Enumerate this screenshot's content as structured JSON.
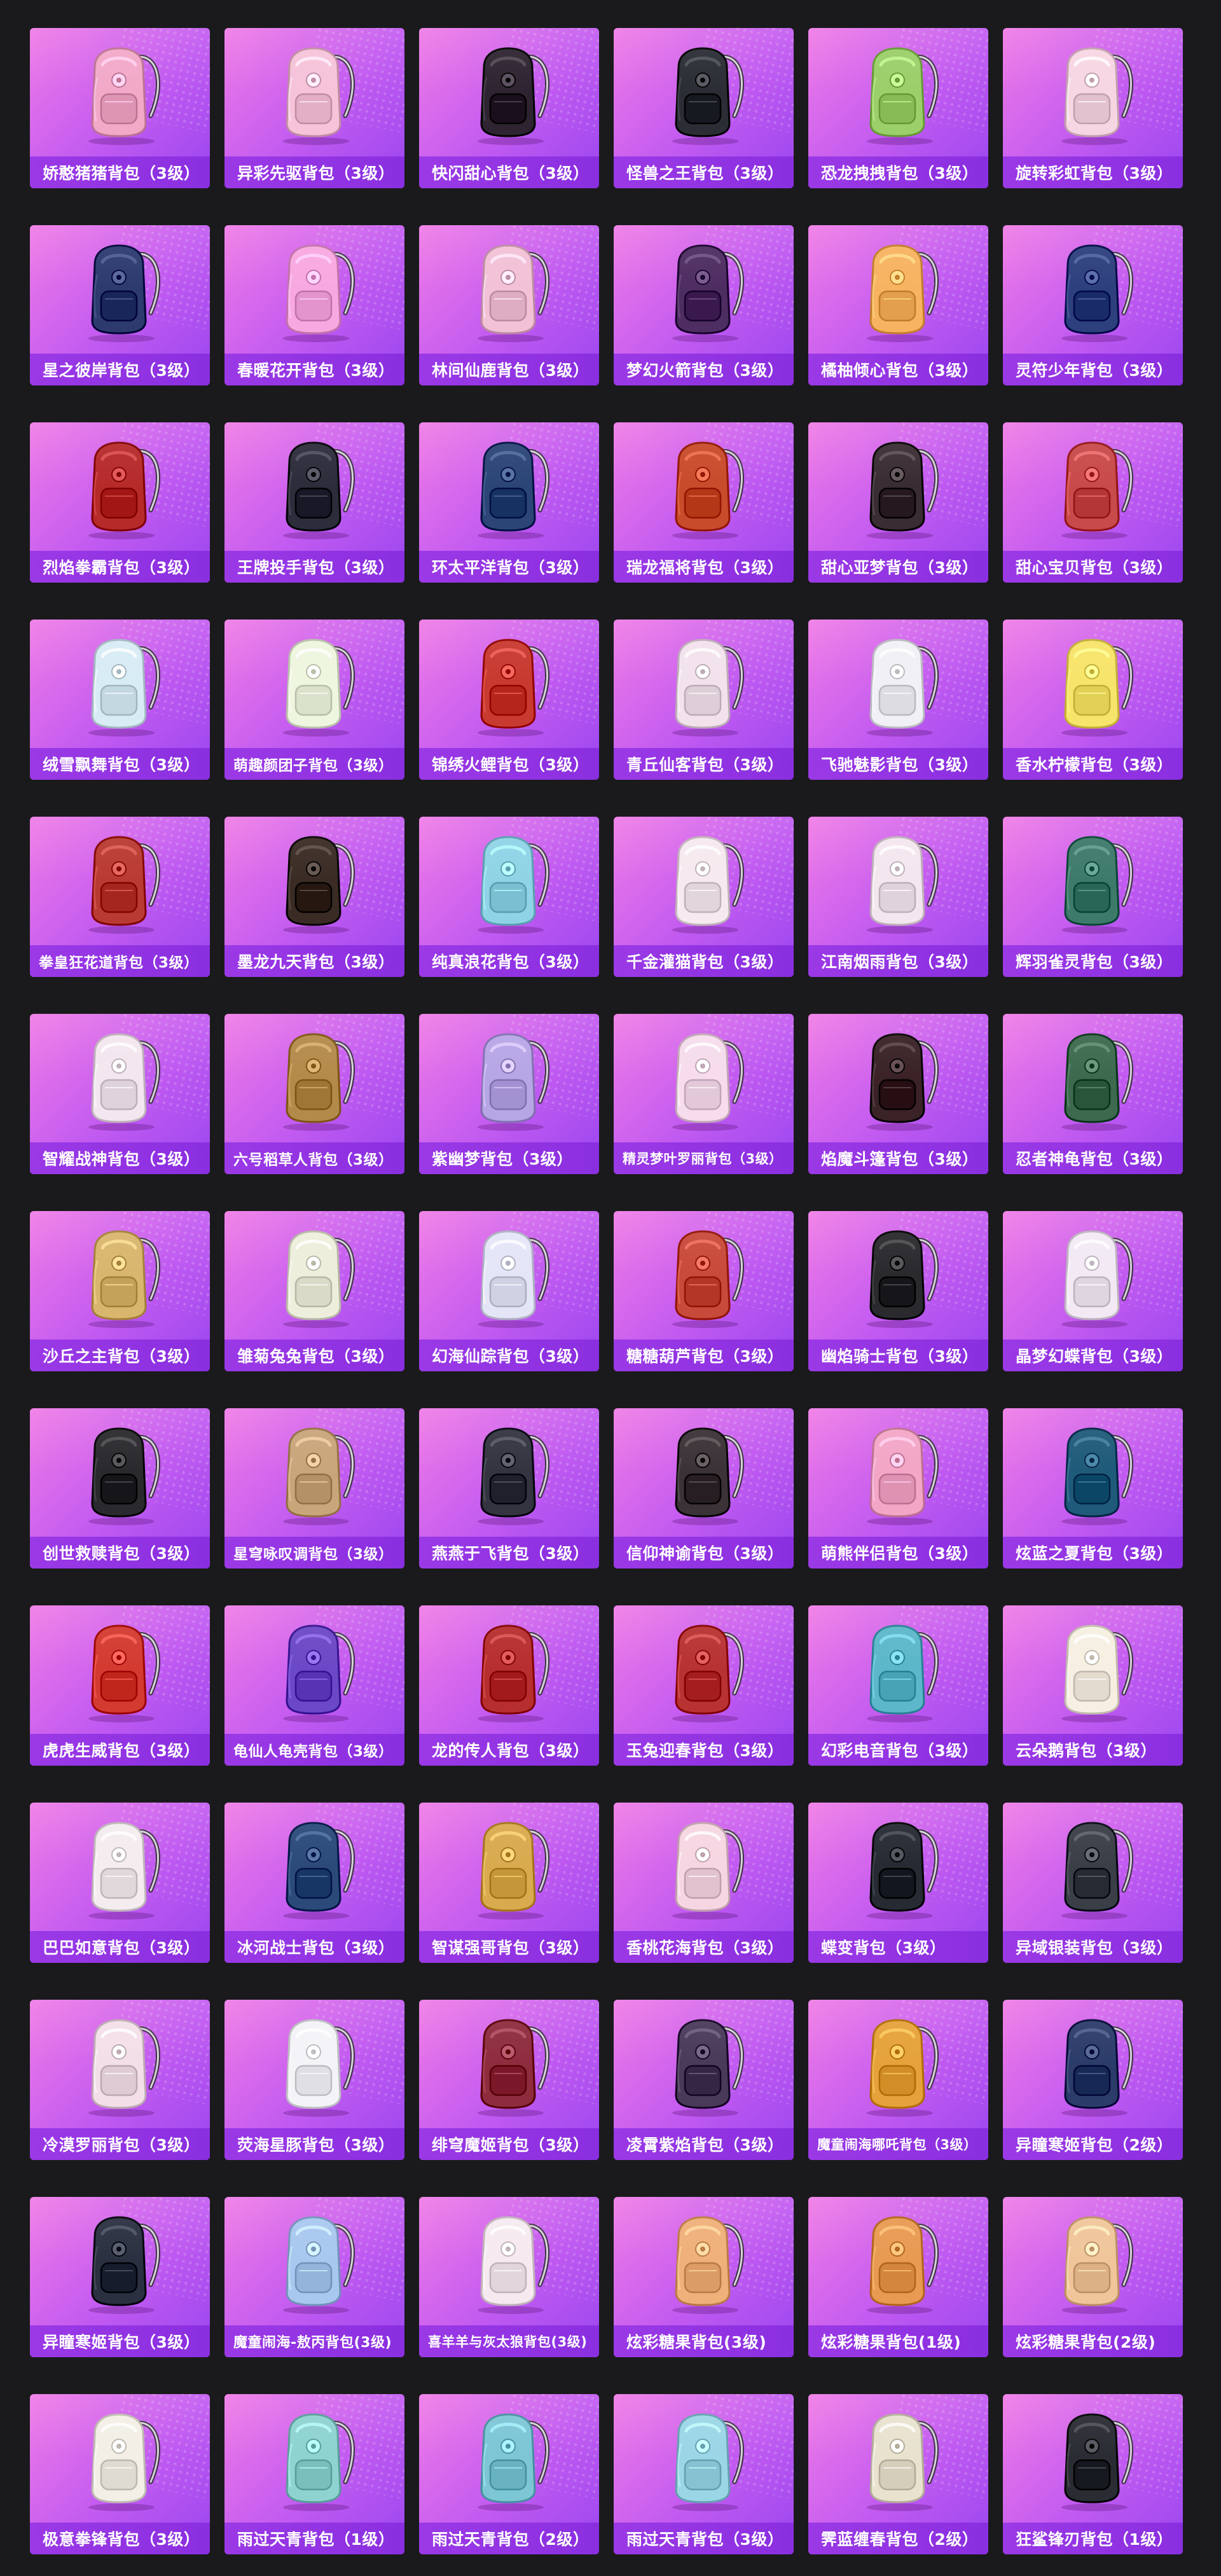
{
  "items": [
    {
      "name": "娇憨猪猪背包（3级）",
      "icon": "pink-pig-backpack-icon",
      "color": "#f2a9c8"
    },
    {
      "name": "异彩先驱背包（3级）",
      "icon": "colorful-pioneer-backpack-icon",
      "color": "#f6c3d9"
    },
    {
      "name": "快闪甜心背包（3级）",
      "icon": "sweetheart-backpack-icon",
      "color": "#2e2431"
    },
    {
      "name": "怪兽之王背包（3级）",
      "icon": "monster-king-backpack-icon",
      "color": "#2b2d35"
    },
    {
      "name": "恐龙拽拽背包（3级）",
      "icon": "dinosaur-backpack-icon",
      "color": "#9bcf6a"
    },
    {
      "name": "旋转彩虹背包（3级）",
      "icon": "rainbow-backpack-icon",
      "color": "#f7d6e3"
    },
    {
      "name": "星之彼岸背包（3级）",
      "icon": "star-shore-backpack-icon",
      "color": "#2c3a6e"
    },
    {
      "name": "春暖花开背包（3级）",
      "icon": "spring-flower-backpack-icon",
      "color": "#f8a8e0"
    },
    {
      "name": "林间仙鹿背包（3级）",
      "icon": "forest-deer-backpack-icon",
      "color": "#f2c1d6"
    },
    {
      "name": "梦幻火箭背包（3级）",
      "icon": "dream-rocket-backpack-icon",
      "color": "#4e2d62"
    },
    {
      "name": "橘柚倾心背包（3级）",
      "icon": "citrus-backpack-icon",
      "color": "#f7b360"
    },
    {
      "name": "灵符少年背包（3级）",
      "icon": "talisman-backpack-icon",
      "color": "#2d3f7d"
    },
    {
      "name": "烈焰拳霸背包（3级）",
      "icon": "flame-fist-backpack-icon",
      "color": "#b62a2a"
    },
    {
      "name": "王牌投手背包（3级）",
      "icon": "ace-pitcher-backpack-icon",
      "color": "#2c2c3b"
    },
    {
      "name": "环太平洋背包（3级）",
      "icon": "pacific-rim-backpack-icon",
      "color": "#2b4577"
    },
    {
      "name": "瑞龙福将背包（3级）",
      "icon": "lucky-dragon-backpack-icon",
      "color": "#c84b2b"
    },
    {
      "name": "甜心亚梦背包（3级）",
      "icon": "sweet-dream-backpack-icon",
      "color": "#3a2c33"
    },
    {
      "name": "甜心宝贝背包（3级）",
      "icon": "cake-backpack-icon",
      "color": "#c94a4a"
    },
    {
      "name": "绒雪飘舞背包（3级）",
      "icon": "snow-dance-backpack-icon",
      "color": "#d8ecf5"
    },
    {
      "name": "萌趣颜团子背包（3级）",
      "icon": "cute-dumpling-backpack-icon",
      "color": "#eef6df"
    },
    {
      "name": "锦绣火鲤背包（3级）",
      "icon": "fire-carp-backpack-icon",
      "color": "#c8392f"
    },
    {
      "name": "青丘仙客背包（3级）",
      "icon": "fox-fairy-backpack-icon",
      "color": "#f2e2ec"
    },
    {
      "name": "飞驰魅影背包（3级）",
      "icon": "speed-phantom-backpack-icon",
      "color": "#f0f0f6"
    },
    {
      "name": "香水柠檬背包（3级）",
      "icon": "lemon-duck-backpack-icon",
      "color": "#f7e46a"
    },
    {
      "name": "拳皇狂花道背包（3级）",
      "icon": "kof-backpack-icon",
      "color": "#b93a32"
    },
    {
      "name": "墨龙九天背包（3级）",
      "icon": "ink-dragon-backpack-icon",
      "color": "#3a2c24"
    },
    {
      "name": "纯真浪花背包（3级）",
      "icon": "wave-drink-backpack-icon",
      "color": "#8fd4e6"
    },
    {
      "name": "千金灌猫背包（3级）",
      "icon": "lady-cat-backpack-icon",
      "color": "#f6e9ef"
    },
    {
      "name": "江南烟雨背包（3级）",
      "icon": "jiangnan-rain-backpack-icon",
      "color": "#f4e6ef"
    },
    {
      "name": "辉羽雀灵背包（3级）",
      "icon": "feather-bird-backpack-icon",
      "color": "#3e7a6a"
    },
    {
      "name": "智耀战神背包（3级）",
      "icon": "war-god-backpack-icon",
      "color": "#f3e6ef"
    },
    {
      "name": "六号稻草人背包（3级）",
      "icon": "scarecrow-backpack-icon",
      "color": "#b48a4a"
    },
    {
      "name": "紫幽梦背包（3级）",
      "icon": "purple-dream-backpack-icon",
      "color": "#b7a6e6"
    },
    {
      "name": "精灵梦叶罗丽背包（3级）",
      "icon": "fairy-leaf-backpack-icon",
      "color": "#f6dcec"
    },
    {
      "name": "焰魔斗篷背包（3级）",
      "icon": "flame-cloak-backpack-icon",
      "color": "#3a2226"
    },
    {
      "name": "忍者神龟背包（3级）",
      "icon": "ninja-turtle-backpack-icon",
      "color": "#3d6a4e"
    },
    {
      "name": "沙丘之主背包（3级）",
      "icon": "dune-lord-backpack-icon",
      "color": "#d9b66e"
    },
    {
      "name": "雏菊兔兔背包（3级）",
      "icon": "daisy-bunny-backpack-icon",
      "color": "#eeeedc"
    },
    {
      "name": "幻海仙踪背包（3级）",
      "icon": "sea-fairy-backpack-icon",
      "color": "#e4e6f8"
    },
    {
      "name": "糖糖葫芦背包（3级）",
      "icon": "candied-haws-backpack-icon",
      "color": "#c84a3a"
    },
    {
      "name": "幽焰骑士背包（3级）",
      "icon": "shadow-knight-backpack-icon",
      "color": "#2a2a2e"
    },
    {
      "name": "晶梦幻蝶背包（3级）",
      "icon": "crystal-butterfly-backpack-icon",
      "color": "#f2e9f4"
    },
    {
      "name": "创世救赎背包（3级）",
      "icon": "genesis-backpack-icon",
      "color": "#2a2a2e"
    },
    {
      "name": "星穹咏叹调背包（3级）",
      "icon": "star-aria-backpack-icon",
      "color": "#c9a57a"
    },
    {
      "name": "燕燕于飞背包（3级）",
      "icon": "swallow-backpack-icon",
      "color": "#343441"
    },
    {
      "name": "信仰神谕背包（3级）",
      "icon": "oracle-backpack-icon",
      "color": "#3a3236"
    },
    {
      "name": "萌熊伴侣背包（3级）",
      "icon": "pink-bear-backpack-icon",
      "color": "#f3a6c6"
    },
    {
      "name": "炫蓝之夏背包（3级）",
      "icon": "blue-summer-backpack-icon",
      "color": "#1f5a7a"
    },
    {
      "name": "虎虎生威背包（3级）",
      "icon": "tiger-backpack-icon",
      "color": "#d33a30"
    },
    {
      "name": "龟仙人龟壳背包（3级）",
      "icon": "turtle-shell-backpack-icon",
      "color": "#6b48c6"
    },
    {
      "name": "龙的传人背包（3级）",
      "icon": "dragon-heir-backpack-icon",
      "color": "#b72e2e"
    },
    {
      "name": "玉兔迎春背包（3级）",
      "icon": "jade-rabbit-backpack-icon",
      "color": "#b83232"
    },
    {
      "name": "幻彩电音背包（3级）",
      "icon": "electro-backpack-icon",
      "color": "#5bb7c9"
    },
    {
      "name": "云朵鹅背包（3级）",
      "icon": "cloud-goose-backpack-icon",
      "color": "#f6efe2"
    },
    {
      "name": "巴巴如意背包（3级）",
      "icon": "ruyi-backpack-icon",
      "color": "#f4ecee"
    },
    {
      "name": "冰河战士背包（3级）",
      "icon": "glacier-warrior-backpack-icon",
      "color": "#2b4a7a"
    },
    {
      "name": "智谋强哥背包（3级）",
      "icon": "clever-bro-backpack-icon",
      "color": "#d9aa4e"
    },
    {
      "name": "香桃花海背包（3级）",
      "icon": "peach-flower-backpack-icon",
      "color": "#f6d6e2"
    },
    {
      "name": "蝶变背包（3级）",
      "icon": "butterfly-change-backpack-icon",
      "color": "#252a33"
    },
    {
      "name": "异域银装背包（3级）",
      "icon": "exotic-silver-backpack-icon",
      "color": "#3a3e47"
    },
    {
      "name": "冷漠罗丽背包（3级）",
      "icon": "cold-loli-backpack-icon",
      "color": "#f3dfe8"
    },
    {
      "name": "荧海星豚背包（3级）",
      "icon": "star-dolphin-backpack-icon",
      "color": "#f3f3f8"
    },
    {
      "name": "绯穹魔姬背包（3级）",
      "icon": "crimson-witch-backpack-icon",
      "color": "#8e2c3e"
    },
    {
      "name": "凌霄紫焰背包（3级）",
      "icon": "purple-flame-backpack-icon",
      "color": "#4a3a5a"
    },
    {
      "name": "魔童闹海哪吒背包（3级）",
      "icon": "nezha-backpack-icon",
      "color": "#e6a23a"
    },
    {
      "name": "异瞳寒姬背包（2级）",
      "icon": "frost-maiden-backpack-icon",
      "color": "#2c3c6a"
    },
    {
      "name": "异瞳寒姬背包（3级）",
      "icon": "frost-maiden-rabbit-backpack-icon",
      "color": "#2a3040"
    },
    {
      "name": "魔童闹海-敖丙背包(3级)",
      "icon": "aobing-backpack-icon",
      "color": "#a9c8ef"
    },
    {
      "name": "喜羊羊与灰太狼背包(3级)",
      "icon": "pleasant-goat-backpack-icon",
      "color": "#f6eaf0"
    },
    {
      "name": "炫彩糖果背包(3级)",
      "icon": "candy-donut-backpack-icon",
      "color": "#f0b07a"
    },
    {
      "name": "炫彩糖果背包(1级)",
      "icon": "candy-donut-lv1-backpack-icon",
      "color": "#e89a52"
    },
    {
      "name": "炫彩糖果背包(2级)",
      "icon": "candy-donut-lv2-backpack-icon",
      "color": "#f0c59a"
    },
    {
      "name": "极意拳锋背包（3级）",
      "icon": "fist-edge-backpack-icon",
      "color": "#f3efe6"
    },
    {
      "name": "雨过天青背包（1级）",
      "icon": "celadon-lv1-backpack-icon",
      "color": "#8ed3d0"
    },
    {
      "name": "雨过天青背包（2级）",
      "icon": "celadon-lv2-backpack-icon",
      "color": "#7cc6d6"
    },
    {
      "name": "雨过天青背包（3级）",
      "icon": "celadon-lv3-backpack-icon",
      "color": "#9bd6e6"
    },
    {
      "name": "霁蓝缠春背包（2级）",
      "icon": "azure-spring-backpack-icon",
      "color": "#e8e2cf"
    },
    {
      "name": "狂鲨锋刃背包（1级）",
      "icon": "shark-blade-backpack-icon",
      "color": "#2a2c33"
    }
  ]
}
